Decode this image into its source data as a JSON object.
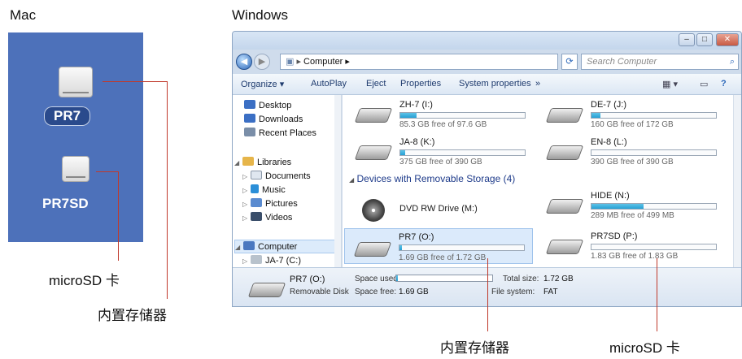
{
  "headings": {
    "mac": "Mac",
    "windows": "Windows"
  },
  "mac": {
    "drives": [
      {
        "label": "PR7"
      },
      {
        "label": "PR7SD"
      }
    ]
  },
  "callouts": {
    "mac_microsd": "microSD 卡",
    "mac_internal": "内置存储器",
    "win_internal": "内置存储器",
    "win_microsd": "microSD 卡"
  },
  "window": {
    "address": [
      "Computer",
      "▸"
    ],
    "search_placeholder": "Search Computer",
    "toolbar": [
      "Organize ▾",
      "AutoPlay",
      "Eject",
      "Properties",
      "System properties",
      "»"
    ],
    "nav": [
      {
        "label": "Desktop",
        "icon": "desktop-icon",
        "color": "#3b6fc4"
      },
      {
        "label": "Downloads",
        "icon": "downloads-icon",
        "color": "#3b6fc4"
      },
      {
        "label": "Recent Places",
        "icon": "recent-places-icon",
        "color": "#7a8ea8"
      },
      {
        "label": "Libraries",
        "icon": "libraries-icon",
        "color": "#e6b54a"
      },
      {
        "label": "Documents",
        "icon": "documents-icon",
        "color": "#dfe6ef"
      },
      {
        "label": "Music",
        "icon": "music-icon",
        "color": "#2b8fd8"
      },
      {
        "label": "Pictures",
        "icon": "pictures-icon",
        "color": "#5a8bd0"
      },
      {
        "label": "Videos",
        "icon": "videos-icon",
        "color": "#3a4e6a"
      },
      {
        "label": "Computer",
        "icon": "computer-icon",
        "color": "#4a78c0"
      },
      {
        "label": "JA-7 (C:)",
        "icon": "drive-icon",
        "color": "#b8c2cc"
      }
    ],
    "drives": [
      {
        "name": "ZH-7 (I:)",
        "free": "85.3 GB free of 97.6 GB",
        "used_fraction": 0.13
      },
      {
        "name": "DE-7 (J:)",
        "free": "160 GB free of 172 GB",
        "used_fraction": 0.07
      },
      {
        "name": "JA-8 (K:)",
        "free": "375 GB free of 390 GB",
        "used_fraction": 0.04
      },
      {
        "name": "EN-8 (L:)",
        "free": "390 GB free of 390 GB",
        "used_fraction": 0.0
      }
    ],
    "removable_section": "Devices with Removable Storage (4)",
    "removable": [
      {
        "name": "DVD RW Drive (M:)"
      },
      {
        "name": "HIDE (N:)",
        "free": "289 MB free of 499 MB",
        "used_fraction": 0.42
      },
      {
        "name": "PR7 (O:)",
        "free": "1.69 GB free of 1.72 GB",
        "used_fraction": 0.02
      },
      {
        "name": "PR7SD (P:)",
        "free": "1.83 GB free of 1.83 GB",
        "used_fraction": 0.0
      }
    ],
    "details": {
      "name": "PR7 (O:)",
      "type": "Removable Disk",
      "space_used_label": "Space used:",
      "space_free_label": "Space free:",
      "space_free": "1.69 GB",
      "total_size_label": "Total size:",
      "total_size": "1.72 GB",
      "file_system_label": "File system:",
      "file_system": "FAT",
      "used_fraction": 0.02
    }
  }
}
